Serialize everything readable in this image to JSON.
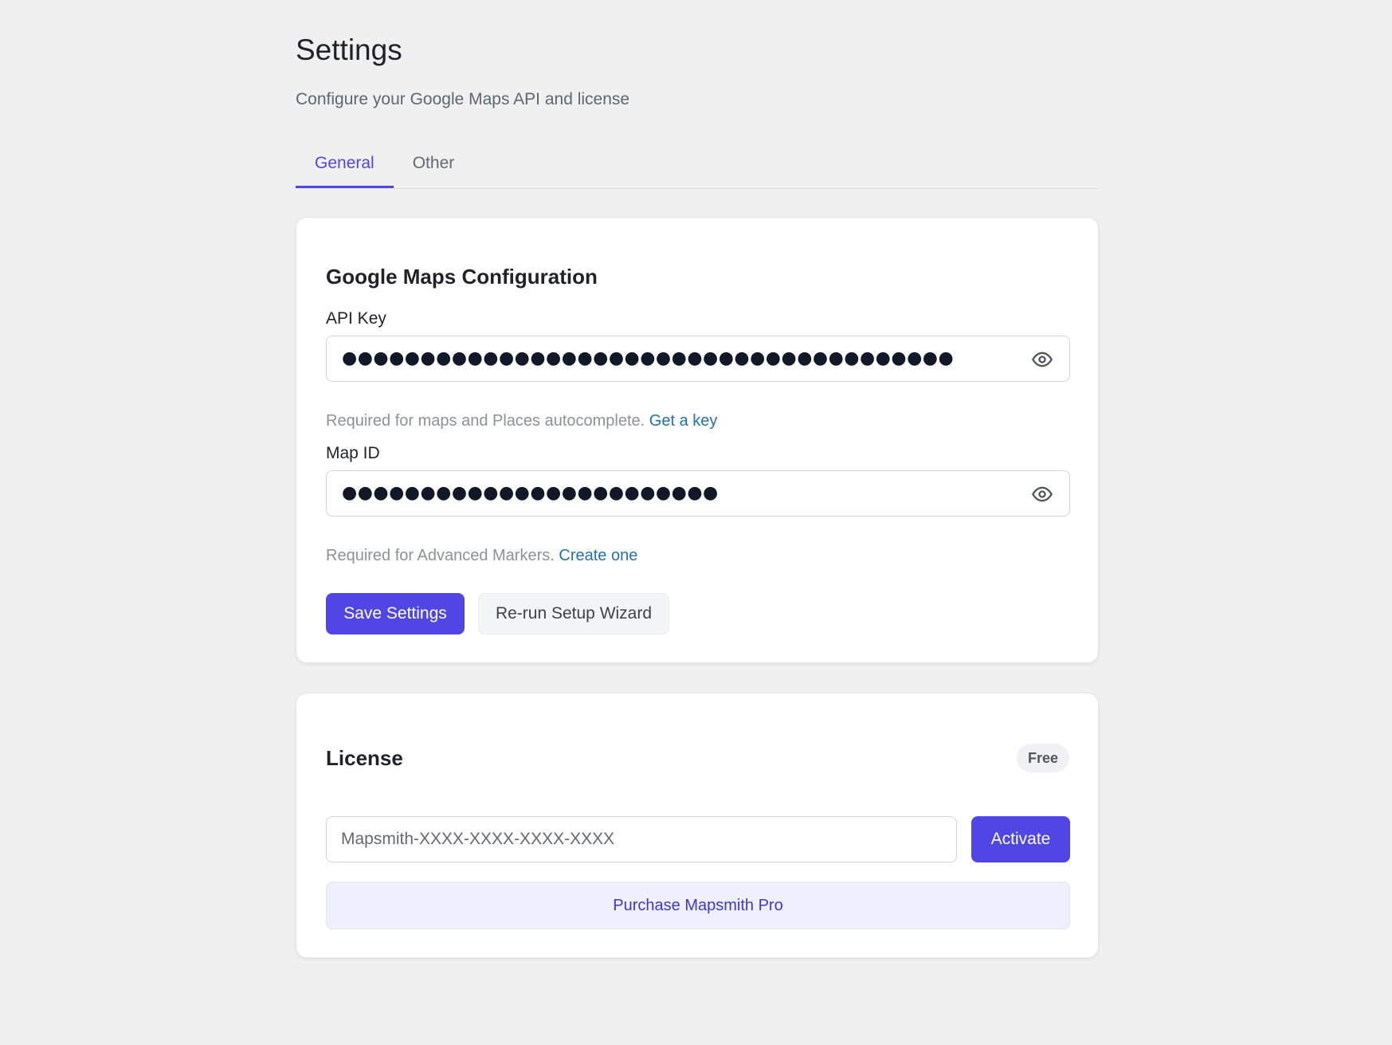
{
  "header": {
    "title": "Settings",
    "subtitle": "Configure your Google Maps API and license"
  },
  "tabs": [
    {
      "label": "General",
      "active": true
    },
    {
      "label": "Other",
      "active": false
    }
  ],
  "maps_card": {
    "heading": "Google Maps Configuration",
    "api_key": {
      "label": "API Key",
      "masked_value": "●●●●●●●●●●●●●●●●●●●●●●●●●●●●●●●●●●●●●●●",
      "help_text": "Required for maps and Places autocomplete.",
      "help_link": "Get a key",
      "toggle_icon": "eye-icon"
    },
    "map_id": {
      "label": "Map ID",
      "masked_value": "●●●●●●●●●●●●●●●●●●●●●●●●",
      "help_text": "Required for Advanced Markers.",
      "help_link": "Create one",
      "toggle_icon": "eye-icon"
    },
    "save_label": "Save Settings",
    "wizard_label": "Re-run Setup Wizard"
  },
  "license_card": {
    "heading": "License",
    "badge": "Free",
    "input_placeholder": "Mapsmith-XXXX-XXXX-XXXX-XXXX",
    "input_value": "",
    "activate_label": "Activate",
    "purchase_label": "Purchase Mapsmith Pro"
  },
  "colors": {
    "accent": "#4f46e5",
    "link": "#2271b1",
    "background": "#f0f0f1"
  }
}
